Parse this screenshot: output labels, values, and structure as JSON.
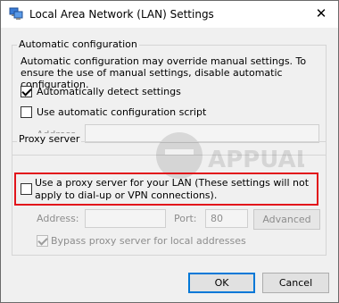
{
  "window": {
    "title": "Local Area Network (LAN) Settings",
    "close_glyph": "✕"
  },
  "auto_config": {
    "group_label": "Automatic configuration",
    "description": "Automatic configuration may override manual settings.  To ensure the use of manual settings, disable automatic configuration.",
    "detect": {
      "label": "Automatically detect settings",
      "checked": true
    },
    "script": {
      "label": "Use automatic configuration script",
      "checked": false
    },
    "address_label": "Address",
    "address_value": ""
  },
  "proxy": {
    "group_label": "Proxy server",
    "use_proxy": {
      "label": "Use a proxy server for your LAN (These settings will not apply to dial-up or VPN connections).",
      "checked": false
    },
    "address_label": "Address:",
    "address_value": "",
    "port_label": "Port:",
    "port_value": "80",
    "advanced_label": "Advanced",
    "bypass": {
      "label": "Bypass proxy server for local addresses",
      "checked": true
    }
  },
  "buttons": {
    "ok": "OK",
    "cancel": "Cancel"
  },
  "colors": {
    "highlight": "#e2141b",
    "focus": "#0078d7",
    "face": "#f0f0f0"
  },
  "watermark": {
    "text": "APPUALS"
  }
}
